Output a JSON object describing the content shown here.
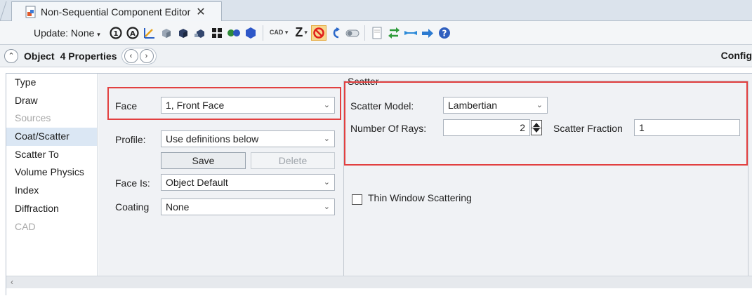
{
  "window": {
    "tab_title": "Non-Sequential Component Editor"
  },
  "toolbar": {
    "update_label": "Update: None",
    "cad_label": "CAD",
    "z_label": "Z"
  },
  "object_bar": {
    "object_label": "Object",
    "properties_label": "4 Properties",
    "config_label": "Config"
  },
  "sidebar": {
    "items": [
      {
        "label": "Type",
        "state": "normal"
      },
      {
        "label": "Draw",
        "state": "normal"
      },
      {
        "label": "Sources",
        "state": "disabled"
      },
      {
        "label": "Coat/Scatter",
        "state": "selected"
      },
      {
        "label": "Scatter To",
        "state": "normal"
      },
      {
        "label": "Volume Physics",
        "state": "normal"
      },
      {
        "label": "Index",
        "state": "normal"
      },
      {
        "label": "Diffraction",
        "state": "normal"
      },
      {
        "label": "CAD",
        "state": "disabled"
      }
    ]
  },
  "form": {
    "face_label": "Face",
    "face_value": "1, Front Face",
    "profile_label": "Profile:",
    "profile_value": "Use definitions below",
    "save_label": "Save",
    "delete_label": "Delete",
    "face_is_label": "Face Is:",
    "face_is_value": "Object Default",
    "coating_label": "Coating",
    "coating_value": "None"
  },
  "scatter": {
    "group_title": "Scatter",
    "model_label": "Scatter Model:",
    "model_value": "Lambertian",
    "rays_label": "Number Of Rays:",
    "rays_value": "2",
    "fraction_label": "Scatter Fraction",
    "fraction_value": "1",
    "thin_window_label": "Thin Window Scattering",
    "thin_window_checked": false
  },
  "colors": {
    "highlight_box": "#e24040",
    "selected_item_bg": "#dbe7f4",
    "active_tool_bg": "#f7d78e"
  }
}
